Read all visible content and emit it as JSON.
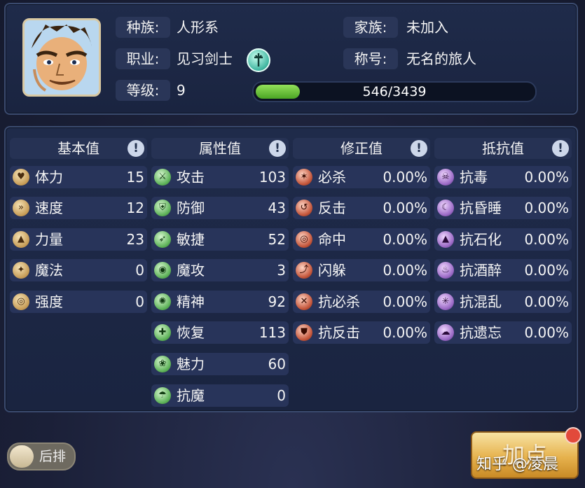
{
  "profile": {
    "race_label": "种族:",
    "race_value": "人形系",
    "job_label": "职业:",
    "job_value": "见习剑士",
    "level_label": "等级:",
    "level_value": "9",
    "family_label": "家族:",
    "family_value": "未加入",
    "title_label": "称号:",
    "title_value": "无名的旅人",
    "exp_text": "546/3439",
    "exp_current": 546,
    "exp_max": 3439
  },
  "columns": [
    {
      "header": "基本值",
      "info": "!"
    },
    {
      "header": "属性值",
      "info": "!"
    },
    {
      "header": "修正值",
      "info": "!"
    },
    {
      "header": "抵抗值",
      "info": "!"
    }
  ],
  "basic": [
    {
      "icon": "heart-icon",
      "label": "体力",
      "value": "15"
    },
    {
      "icon": "speed-icon",
      "label": "速度",
      "value": "12"
    },
    {
      "icon": "strength-icon",
      "label": "力量",
      "value": "23"
    },
    {
      "icon": "magic-icon",
      "label": "魔法",
      "value": "0"
    },
    {
      "icon": "toughness-icon",
      "label": "强度",
      "value": "0"
    }
  ],
  "attributes": [
    {
      "icon": "attack-icon",
      "label": "攻击",
      "value": "103"
    },
    {
      "icon": "defense-icon",
      "label": "防御",
      "value": "43"
    },
    {
      "icon": "agility-icon",
      "label": "敏捷",
      "value": "52"
    },
    {
      "icon": "magic-attack-icon",
      "label": "魔攻",
      "value": "3"
    },
    {
      "icon": "spirit-icon",
      "label": "精神",
      "value": "92"
    },
    {
      "icon": "recovery-icon",
      "label": "恢复",
      "value": "113"
    },
    {
      "icon": "charm-icon",
      "label": "魅力",
      "value": "60"
    },
    {
      "icon": "magic-resist-icon",
      "label": "抗魔",
      "value": "0"
    }
  ],
  "modifiers": [
    {
      "icon": "critical-icon",
      "label": "必杀",
      "value": "0.00%"
    },
    {
      "icon": "counter-icon",
      "label": "反击",
      "value": "0.00%"
    },
    {
      "icon": "hit-icon",
      "label": "命中",
      "value": "0.00%"
    },
    {
      "icon": "dodge-icon",
      "label": "闪躲",
      "value": "0.00%"
    },
    {
      "icon": "anti-critical-icon",
      "label": "抗必杀",
      "value": "0.00%"
    },
    {
      "icon": "anti-counter-icon",
      "label": "抗反击",
      "value": "0.00%"
    }
  ],
  "resistances": [
    {
      "icon": "poison-icon",
      "label": "抗毒",
      "value": "0.00%"
    },
    {
      "icon": "sleep-icon",
      "label": "抗昏睡",
      "value": "0.00%"
    },
    {
      "icon": "petrify-icon",
      "label": "抗石化",
      "value": "0.00%"
    },
    {
      "icon": "drunk-icon",
      "label": "抗酒醉",
      "value": "0.00%"
    },
    {
      "icon": "confusion-icon",
      "label": "抗混乱",
      "value": "0.00%"
    },
    {
      "icon": "forget-icon",
      "label": "抗遗忘",
      "value": "0.00%"
    }
  ],
  "footer": {
    "position_toggle": "后排",
    "add_points": "加点",
    "watermark": "知乎 @凌晨"
  }
}
